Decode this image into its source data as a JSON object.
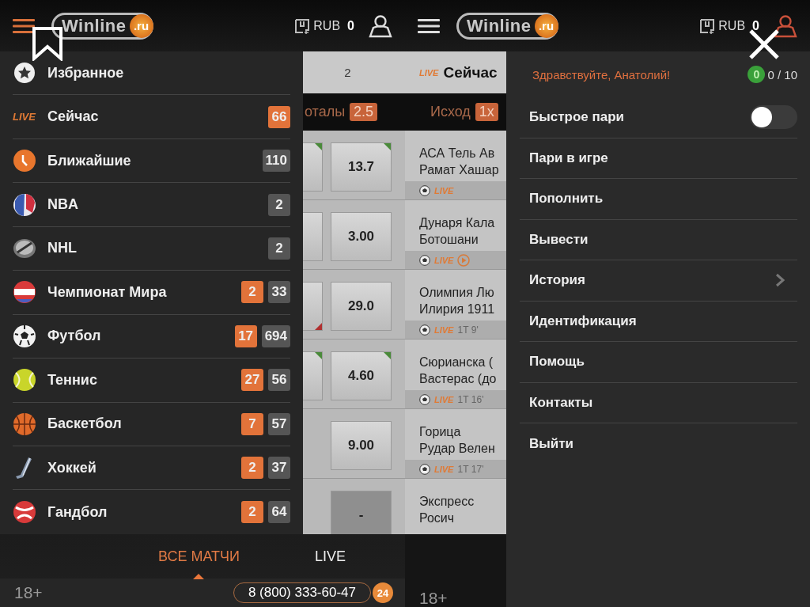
{
  "left_screen": {
    "header": {
      "menu_open": true,
      "logo": {
        "name": "Winline",
        "domain": ".ru"
      },
      "currency": "RUB",
      "balance": "0",
      "account_open": false
    },
    "sports_menu": {
      "items": [
        {
          "kind": "icon",
          "label": "Избранное"
        },
        {
          "kind": "live",
          "tag": "LIVE",
          "label": "Сейчас",
          "counts": [
            {
              "value": "66",
              "live": true
            }
          ]
        },
        {
          "kind": "icon",
          "label": "Ближайшие",
          "counts": [
            {
              "value": "110",
              "live": false
            }
          ]
        },
        {
          "kind": "icon",
          "label": "NBA",
          "counts": [
            {
              "value": "2",
              "live": false
            }
          ]
        },
        {
          "kind": "icon",
          "label": "NHL",
          "counts": [
            {
              "value": "2",
              "live": false
            }
          ]
        },
        {
          "kind": "icon",
          "label": "Чемпионат Мира",
          "counts": [
            {
              "value": "2",
              "live": true
            },
            {
              "value": "33",
              "live": false
            }
          ]
        },
        {
          "kind": "icon",
          "label": "Футбол",
          "counts": [
            {
              "value": "17",
              "live": true
            },
            {
              "value": "694",
              "live": false
            }
          ]
        },
        {
          "kind": "icon",
          "label": "Теннис",
          "counts": [
            {
              "value": "27",
              "live": true
            },
            {
              "value": "56",
              "live": false
            }
          ]
        },
        {
          "kind": "icon",
          "label": "Баскетбол",
          "counts": [
            {
              "value": "7",
              "live": true
            },
            {
              "value": "57",
              "live": false
            }
          ]
        },
        {
          "kind": "icon",
          "label": "Хоккей",
          "counts": [
            {
              "value": "2",
              "live": true
            },
            {
              "value": "37",
              "live": false
            }
          ]
        },
        {
          "kind": "icon",
          "label": "Гандбол",
          "counts": [
            {
              "value": "2",
              "live": true
            },
            {
              "value": "64",
              "live": false
            }
          ]
        }
      ]
    },
    "match_list": {
      "header_count": "2",
      "tab": {
        "label": "оталы",
        "badge": "2.5"
      },
      "rows": [
        {
          "prev_shown": true,
          "prev_rising": true,
          "prev_falling": false,
          "odds": "13.7",
          "odds_rising": true,
          "disabled": false
        },
        {
          "prev_shown": true,
          "prev_rising": false,
          "prev_falling": false,
          "odds": "3.00",
          "odds_rising": false,
          "disabled": false
        },
        {
          "prev_shown": true,
          "prev_rising": false,
          "prev_falling": true,
          "odds": "29.0",
          "odds_rising": false,
          "disabled": false
        },
        {
          "prev_shown": true,
          "prev_rising": true,
          "prev_falling": false,
          "odds": "4.60",
          "odds_rising": true,
          "disabled": false
        },
        {
          "prev_shown": false,
          "odds": "9.00",
          "odds_rising": false,
          "disabled": false
        },
        {
          "prev_shown": false,
          "odds": "-",
          "odds_rising": false,
          "disabled": true
        }
      ]
    },
    "footer": {
      "tabs": [
        {
          "label": "ВСЕ МАТЧИ",
          "selected": true
        },
        {
          "label": "LIVE",
          "selected": false
        }
      ],
      "age": "18+",
      "phone": "8 (800) 333-60-47",
      "hours": "24"
    }
  },
  "right_screen": {
    "header": {
      "menu_open": false,
      "logo": {
        "name": "Winline",
        "domain": ".ru"
      },
      "currency": "RUB",
      "balance": "0",
      "account_open": true
    },
    "match_list": {
      "header": {
        "tag": "LIVE",
        "title": "Сейчас"
      },
      "tab": {
        "label": "Исход",
        "badge": "1x"
      },
      "rows": [
        {
          "teams": [
            "АСА Тель Ав",
            "Рамат Хашар"
          ],
          "live": {
            "tag": "LIVE",
            "video": false
          }
        },
        {
          "teams": [
            "Дунаря Кала",
            "Ботошани"
          ],
          "live": {
            "tag": "LIVE",
            "video": true
          }
        },
        {
          "teams": [
            "Олимпия Лю",
            "Илирия 1911"
          ],
          "live": {
            "tag": "LIVE",
            "video": false,
            "time": "1Т 9'"
          }
        },
        {
          "teams": [
            "Сюрианска (",
            "Вастерас (до"
          ],
          "live": {
            "tag": "LIVE",
            "video": false,
            "time": "1Т 16'"
          }
        },
        {
          "teams": [
            "Горица",
            "Рудар Велен"
          ],
          "live": {
            "tag": "LIVE",
            "video": false,
            "time": "1Т 17'"
          }
        },
        {
          "teams": [
            "Экспресс",
            "Росич"
          ]
        }
      ]
    },
    "footer": {
      "age": "18+"
    },
    "account_menu": {
      "greeting": "Здравствуйте, Анатолий!",
      "level_badge": "0",
      "progress": "0 / 10",
      "items": [
        {
          "kind": "toggle",
          "label": "Быстрое пари",
          "on": false
        },
        {
          "kind": "link",
          "label": "Пари в игре"
        },
        {
          "kind": "link",
          "label": "Пополнить"
        },
        {
          "kind": "link",
          "label": "Вывести"
        },
        {
          "kind": "submenu",
          "label": "История"
        },
        {
          "kind": "link",
          "label": "Идентификация"
        },
        {
          "kind": "link",
          "label": "Помощь"
        },
        {
          "kind": "link",
          "label": "Контакты"
        },
        {
          "kind": "link",
          "label": "Выйти"
        }
      ]
    }
  }
}
